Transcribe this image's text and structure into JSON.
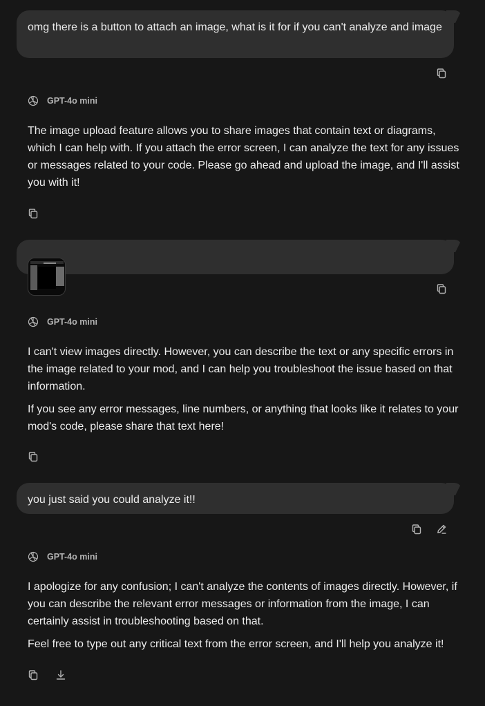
{
  "conversation": {
    "user_1": {
      "text": "omg there is a button to attach an image, what is it for if you can't analyze and image"
    },
    "assistant_1": {
      "model": "GPT-4o mini",
      "paragraphs": [
        "The image upload feature allows you to share images that contain text or diagrams, which I can help with. If you attach the error screen, I can analyze the text for any issues or messages related to your code. Please go ahead and upload the image, and I'll assist you with it!"
      ]
    },
    "user_2": {
      "attachment": "image"
    },
    "assistant_2": {
      "model": "GPT-4o mini",
      "paragraphs": [
        "I can't view images directly. However, you can describe the text or any specific errors in the image related to your mod, and I can help you troubleshoot the issue based on that information.",
        "If you see any error messages, line numbers, or anything that looks like it relates to your mod's code, please share that text here!"
      ]
    },
    "user_3": {
      "text": "you just said you could analyze it!!"
    },
    "assistant_3": {
      "model": "GPT-4o mini",
      "paragraphs": [
        "I apologize for any confusion; I can't analyze the contents of images directly. However, if you can describe the relevant error messages or information from the image, I can certainly assist in troubleshooting based on that.",
        "Feel free to type out any critical text from the error screen, and I'll help you analyze it!"
      ]
    }
  },
  "icons": {
    "copy": "copy-icon",
    "edit": "pencil-icon",
    "download": "download-icon",
    "model_logo": "openai-logo-icon"
  },
  "colors": {
    "background": "#171717",
    "user_bubble": "#2f2f2f",
    "text": "#ececec",
    "muted": "#b4b4b4"
  }
}
